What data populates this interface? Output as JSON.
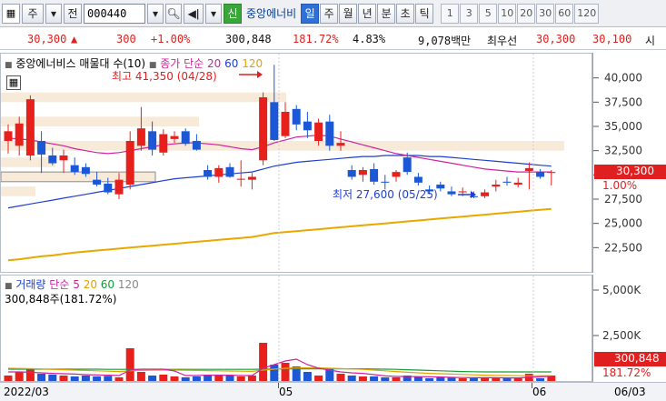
{
  "toolbar": {
    "market_type": "주",
    "prev_label": "전",
    "code_value": "000440",
    "shin_label": "신",
    "stock_name": "중앙에너비",
    "periods": [
      "일",
      "주",
      "월",
      "년",
      "분",
      "초",
      "틱"
    ],
    "active_period": "일",
    "intervals": [
      "1",
      "3",
      "5",
      "10",
      "20",
      "30",
      "60",
      "120"
    ]
  },
  "quote": {
    "price": "30,300",
    "change_arrow": "▲",
    "change": "300",
    "change_pct": "+1.00%",
    "volume": "300,848",
    "volume_ratio": "181.72%",
    "turnover": "4.83%",
    "amount": "9,078백만",
    "best_label": "최우선",
    "ask": "30,300",
    "bid": "30,100",
    "tail_label": "시"
  },
  "price_pane": {
    "title": "중앙에너비스 매물대 수(10)",
    "ma_label": "종가 단순",
    "ma_periods": [
      "20",
      "60",
      "120"
    ],
    "high_annotation": "최고 41,350 (04/28)",
    "low_annotation": "최저 27,600 (05/25)",
    "axis_ticks": [
      "40,000",
      "37,500",
      "35,000",
      "32,500",
      "30,000",
      "27,500",
      "25,000",
      "22,500"
    ],
    "current_label": "30,300",
    "current_pct": "1.00%"
  },
  "volume_pane": {
    "title": "거래량",
    "ma_label": "단순",
    "ma_periods": [
      "5",
      "20",
      "60",
      "120"
    ],
    "current_text": "300,848주(181.72%)",
    "axis_ticks": [
      "5,000K",
      "2,500K"
    ],
    "current_label": "300,848",
    "current_pct": "181.72%"
  },
  "x_axis": {
    "labels": [
      "2022/03",
      "05",
      "06",
      "06/03"
    ]
  },
  "chart_data": {
    "type": "candlestick",
    "ylim": [
      20000,
      42500
    ],
    "candles": [
      {
        "o": 33500,
        "h": 35200,
        "l": 32200,
        "c": 34500
      },
      {
        "o": 33000,
        "h": 36000,
        "l": 32000,
        "c": 35300
      },
      {
        "o": 32000,
        "h": 38200,
        "l": 31500,
        "c": 37800
      },
      {
        "o": 33500,
        "h": 34500,
        "l": 30200,
        "c": 32100
      },
      {
        "o": 32000,
        "h": 32800,
        "l": 31000,
        "c": 31200
      },
      {
        "o": 31500,
        "h": 32600,
        "l": 30200,
        "c": 32000
      },
      {
        "o": 31000,
        "h": 31800,
        "l": 30000,
        "c": 30300
      },
      {
        "o": 30800,
        "h": 31200,
        "l": 29800,
        "c": 30100
      },
      {
        "o": 29500,
        "h": 30300,
        "l": 28800,
        "c": 29000
      },
      {
        "o": 29100,
        "h": 29700,
        "l": 28000,
        "c": 28200
      },
      {
        "o": 28000,
        "h": 30200,
        "l": 27500,
        "c": 29500
      },
      {
        "o": 29000,
        "h": 34500,
        "l": 28500,
        "c": 33500
      },
      {
        "o": 33000,
        "h": 37000,
        "l": 32500,
        "c": 34800
      },
      {
        "o": 34500,
        "h": 35500,
        "l": 32000,
        "c": 32600
      },
      {
        "o": 32300,
        "h": 34700,
        "l": 32000,
        "c": 34200
      },
      {
        "o": 33700,
        "h": 34500,
        "l": 33300,
        "c": 34000
      },
      {
        "o": 34500,
        "h": 34800,
        "l": 33000,
        "c": 33200
      },
      {
        "o": 33500,
        "h": 34200,
        "l": 32500,
        "c": 32600
      },
      {
        "o": 30500,
        "h": 31000,
        "l": 29500,
        "c": 29800
      },
      {
        "o": 29800,
        "h": 31000,
        "l": 29200,
        "c": 30700
      },
      {
        "o": 30800,
        "h": 31200,
        "l": 29700,
        "c": 29800
      },
      {
        "o": 29500,
        "h": 31500,
        "l": 28800,
        "c": 29600
      },
      {
        "o": 29500,
        "h": 30200,
        "l": 28500,
        "c": 29800
      },
      {
        "o": 31500,
        "h": 38500,
        "l": 31000,
        "c": 38000
      },
      {
        "o": 37500,
        "h": 41350,
        "l": 33500,
        "c": 33600
      },
      {
        "o": 34000,
        "h": 37500,
        "l": 33800,
        "c": 36500
      },
      {
        "o": 36800,
        "h": 37200,
        "l": 34600,
        "c": 35200
      },
      {
        "o": 35500,
        "h": 36500,
        "l": 33800,
        "c": 34600
      },
      {
        "o": 33500,
        "h": 35800,
        "l": 33000,
        "c": 35400
      },
      {
        "o": 35500,
        "h": 36200,
        "l": 32500,
        "c": 33000
      },
      {
        "o": 33000,
        "h": 34500,
        "l": 32500,
        "c": 33300
      },
      {
        "o": 30500,
        "h": 31000,
        "l": 29500,
        "c": 29800
      },
      {
        "o": 30000,
        "h": 30800,
        "l": 29300,
        "c": 30500
      },
      {
        "o": 30600,
        "h": 31200,
        "l": 29000,
        "c": 29300
      },
      {
        "o": 29300,
        "h": 30000,
        "l": 28500,
        "c": 29200
      },
      {
        "o": 29800,
        "h": 30500,
        "l": 29300,
        "c": 30300
      },
      {
        "o": 31800,
        "h": 32300,
        "l": 30000,
        "c": 30300
      },
      {
        "o": 29800,
        "h": 30200,
        "l": 28900,
        "c": 29200
      },
      {
        "o": 28500,
        "h": 28900,
        "l": 28000,
        "c": 28300
      },
      {
        "o": 29000,
        "h": 29300,
        "l": 28300,
        "c": 28600
      },
      {
        "o": 28300,
        "h": 28800,
        "l": 27800,
        "c": 28000
      },
      {
        "o": 28200,
        "h": 28700,
        "l": 27800,
        "c": 28300
      },
      {
        "o": 27800,
        "h": 28300,
        "l": 27600,
        "c": 27700
      },
      {
        "o": 27800,
        "h": 28500,
        "l": 27600,
        "c": 28200
      },
      {
        "o": 28800,
        "h": 29500,
        "l": 28300,
        "c": 29000
      },
      {
        "o": 29300,
        "h": 29800,
        "l": 28900,
        "c": 29200
      },
      {
        "o": 29000,
        "h": 29700,
        "l": 28700,
        "c": 29200
      },
      {
        "o": 30400,
        "h": 31300,
        "l": 28500,
        "c": 30700
      },
      {
        "o": 30300,
        "h": 30600,
        "l": 29600,
        "c": 29800
      },
      {
        "o": 30200,
        "h": 30500,
        "l": 28900,
        "c": 30300
      }
    ],
    "ma20": [
      33800,
      33700,
      33600,
      33400,
      33200,
      33000,
      32700,
      32500,
      32300,
      32200,
      32300,
      32500,
      32700,
      32900,
      33100,
      33200,
      33300,
      33300,
      33200,
      33100,
      32900,
      32700,
      32600,
      32900,
      33300,
      33600,
      33900,
      34000,
      34100,
      34000,
      33700,
      33400,
      33100,
      32800,
      32500,
      32200,
      32000,
      31800,
      31600,
      31400,
      31200,
      31000,
      30800,
      30600,
      30500,
      30400,
      30300,
      30300,
      30300,
      30300
    ],
    "ma60": [
      26600,
      26800,
      27000,
      27200,
      27400,
      27600,
      27800,
      28000,
      28200,
      28400,
      28600,
      28800,
      29000,
      29200,
      29400,
      29600,
      29700,
      29800,
      29900,
      30000,
      30100,
      30200,
      30300,
      30600,
      30900,
      31100,
      31300,
      31400,
      31500,
      31600,
      31700,
      31800,
      31900,
      31900,
      32000,
      32000,
      32000,
      32000,
      31900,
      31900,
      31800,
      31700,
      31600,
      31500,
      31400,
      31300,
      31200,
      31100,
      31000,
      30900
    ],
    "ma120": [
      21200,
      21300,
      21450,
      21600,
      21700,
      21850,
      22000,
      22100,
      22200,
      22300,
      22400,
      22500,
      22600,
      22700,
      22800,
      22900,
      23000,
      23100,
      23200,
      23300,
      23400,
      23500,
      23600,
      23800,
      24000,
      24100,
      24200,
      24300,
      24400,
      24500,
      24600,
      24700,
      24800,
      24900,
      25000,
      25100,
      25200,
      25300,
      25400,
      25500,
      25600,
      25700,
      25800,
      25900,
      26000,
      26100,
      26200,
      26300,
      26400,
      26500
    ],
    "volume_series": [
      {
        "name": "거래량",
        "values": [
          300,
          500,
          700,
          400,
          350,
          300,
          250,
          300,
          250,
          280,
          200,
          1800,
          500,
          300,
          350,
          250,
          200,
          250,
          350,
          300,
          300,
          250,
          300,
          2100,
          900,
          1000,
          800,
          500,
          300,
          650,
          400,
          300,
          250,
          250,
          200,
          200,
          300,
          250,
          150,
          200,
          180,
          150,
          150,
          200,
          180,
          150,
          200,
          400,
          150,
          300
        ]
      }
    ],
    "volume_ylim": [
      0,
      5500
    ],
    "volume_ma5": [
      500,
      500,
      480,
      450,
      420,
      400,
      380,
      350,
      330,
      320,
      300,
      600,
      650,
      650,
      650,
      550,
      300,
      300,
      320,
      320,
      320,
      300,
      300,
      700,
      900,
      1100,
      1200,
      900,
      700,
      600,
      500,
      450,
      420,
      350,
      280,
      250,
      250,
      240,
      230,
      220,
      200,
      190,
      180,
      180,
      180,
      170,
      170,
      200,
      230,
      260
    ],
    "volume_ma20": [
      700,
      690,
      680,
      660,
      640,
      620,
      600,
      580,
      560,
      540,
      520,
      560,
      580,
      590,
      600,
      600,
      590,
      580,
      570,
      560,
      550,
      540,
      530,
      600,
      650,
      700,
      720,
      720,
      720,
      700,
      680,
      660,
      640,
      600,
      560,
      520,
      480,
      450,
      420,
      400,
      380,
      360,
      340,
      320,
      310,
      300,
      290,
      290,
      290,
      290
    ],
    "volume_ma60": [
      650,
      650,
      650,
      650,
      650,
      650,
      650,
      650,
      650,
      640,
      640,
      640,
      640,
      640,
      640,
      640,
      640,
      640,
      640,
      640,
      640,
      640,
      640,
      650,
      660,
      670,
      670,
      670,
      670,
      670,
      670,
      670,
      670,
      660,
      650,
      640,
      620,
      600,
      580,
      560,
      540,
      520,
      510,
      500,
      500,
      500,
      500,
      500,
      500,
      500
    ]
  }
}
